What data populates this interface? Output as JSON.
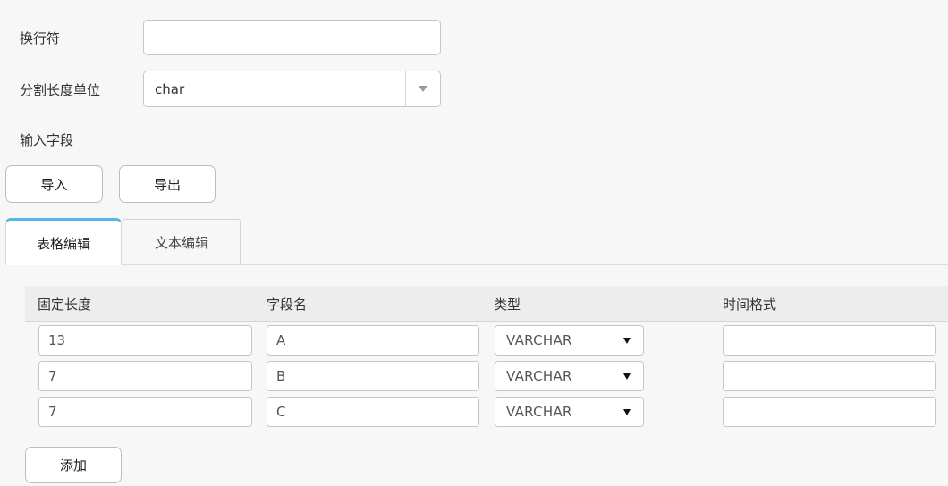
{
  "form": {
    "line_separator_label": "换行符",
    "line_separator_value": "",
    "split_unit_label": "分割长度单位",
    "split_unit_value": "char",
    "input_fields_label": "输入字段"
  },
  "buttons": {
    "import_label": "导入",
    "export_label": "导出",
    "add_label": "添加"
  },
  "tabs": [
    {
      "label": "表格编辑",
      "active": true
    },
    {
      "label": "文本编辑",
      "active": false
    }
  ],
  "table": {
    "headers": [
      "固定长度",
      "字段名",
      "类型",
      "时间格式"
    ],
    "rows": [
      {
        "length": "13",
        "name": "A",
        "type": "VARCHAR",
        "time_format": ""
      },
      {
        "length": "7",
        "name": "B",
        "type": "VARCHAR",
        "time_format": ""
      },
      {
        "length": "7",
        "name": "C",
        "type": "VARCHAR",
        "time_format": ""
      }
    ]
  },
  "colors": {
    "active_tab_accent": "#56b5e8",
    "background": "#f7f7f7"
  }
}
